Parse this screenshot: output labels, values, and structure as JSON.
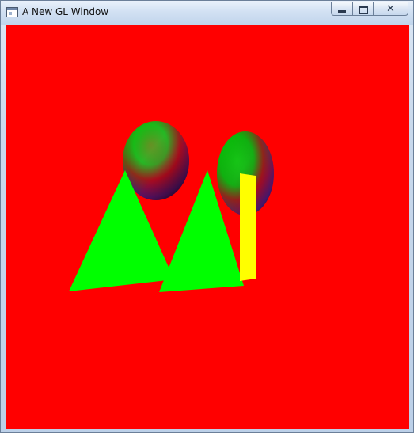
{
  "window": {
    "title": "A New GL Window",
    "icons": {
      "app": "app-window-icon",
      "minimize": "minimize-icon",
      "maximize": "maximize-icon",
      "close": "close-icon"
    },
    "close_glyph": "✕"
  },
  "scene": {
    "background_color": "#ff0000",
    "triangle_color": "#00ff00",
    "bar_color": "#ffff00",
    "sphere_gradient": [
      "#00cc00",
      "#b01020",
      "#1a1a8c"
    ]
  }
}
